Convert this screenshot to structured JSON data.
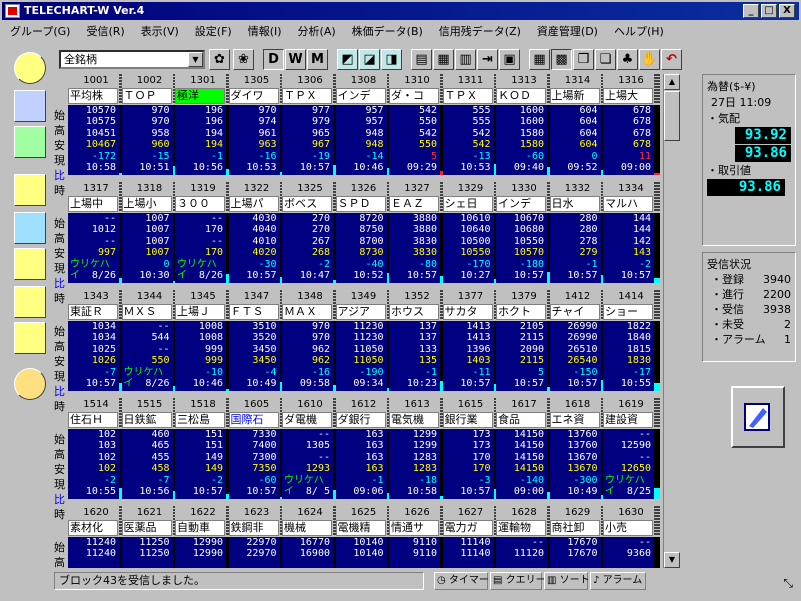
{
  "window": {
    "title": "TELECHART-W Ver.4",
    "min": "_",
    "max": "□",
    "close": "X"
  },
  "menu": [
    "グループ(G)",
    "受信(R)",
    "表示(V)",
    "設定(F)",
    "情報(I)",
    "分析(A)",
    "株価データ(B)",
    "信用残データ(Z)",
    "資産管理(D)",
    "ヘルプ(H)"
  ],
  "toolbar": {
    "combo_value": "全銘柄",
    "btn_d": "D",
    "btn_w": "W",
    "btn_m": "M"
  },
  "row_labels": [
    "始",
    "高",
    "安",
    "現",
    "比",
    "時"
  ],
  "colors": {
    "panel_bg": "#000080",
    "change": "#00ffff",
    "highlight": "#00ff00",
    "lcd": "#00ffff"
  },
  "rows": [
    [
      {
        "code": "1001",
        "name": "平均株",
        "vals": [
          "10570",
          "10575",
          "10451",
          "10467",
          "-172",
          "10:58"
        ]
      },
      {
        "code": "1002",
        "name": "ＴＯＰ",
        "vals": [
          "970",
          "970",
          "958",
          "960",
          "-15",
          "10:51"
        ]
      },
      {
        "code": "1301",
        "name": "極洋",
        "hl": true,
        "vals": [
          "196",
          "196",
          "194",
          "194",
          "-1",
          "10:56"
        ]
      },
      {
        "code": "1305",
        "name": "ダイワ",
        "vals": [
          "970",
          "974",
          "961",
          "963",
          "-16",
          "10:53"
        ]
      },
      {
        "code": "1306",
        "name": "ＴＰＸ",
        "vals": [
          "977",
          "979",
          "965",
          "967",
          "-19",
          "10:57"
        ]
      },
      {
        "code": "1308",
        "name": "インデ",
        "vals": [
          "957",
          "957",
          "948",
          "948",
          "-14",
          "10:46"
        ]
      },
      {
        "code": "1310",
        "name": "ダ・コ",
        "vals": [
          "542",
          "550",
          "542",
          "550",
          "5",
          "09:29"
        ],
        "red": true
      },
      {
        "code": "1311",
        "name": "ＴＰＸ",
        "vals": [
          "555",
          "555",
          "542",
          "542",
          "-13",
          "10:53"
        ]
      },
      {
        "code": "1313",
        "name": "ＫＯＤ",
        "vals": [
          "1600",
          "1600",
          "1580",
          "1580",
          "-60",
          "09:40"
        ]
      },
      {
        "code": "1314",
        "name": "上場新",
        "vals": [
          "604",
          "604",
          "604",
          "604",
          "0",
          "09:52"
        ]
      },
      {
        "code": "1316",
        "name": "上場大",
        "vals": [
          "678",
          "678",
          "678",
          "678",
          "11",
          "09:00"
        ],
        "red": true
      }
    ],
    [
      {
        "code": "1317",
        "name": "上場中",
        "vals": [
          "--",
          "1012",
          "--",
          "997",
          "ウリケハイ",
          "8/26"
        ]
      },
      {
        "code": "1318",
        "name": "上場小",
        "vals": [
          "1007",
          "1007",
          "1007",
          "1007",
          "0",
          "10:30"
        ]
      },
      {
        "code": "1319",
        "name": "３００",
        "vals": [
          "--",
          "170",
          "--",
          "170",
          "ウリケハイ",
          "8/26"
        ]
      },
      {
        "code": "1322",
        "name": "上場パ",
        "vals": [
          "4030",
          "4040",
          "4010",
          "4020",
          "-30",
          "10:57"
        ]
      },
      {
        "code": "1325",
        "name": "ボベス",
        "vals": [
          "270",
          "270",
          "267",
          "268",
          "-2",
          "10:47"
        ]
      },
      {
        "code": "1326",
        "name": "ＳＰＤ",
        "vals": [
          "8720",
          "8750",
          "8700",
          "8730",
          "-40",
          "10:52"
        ]
      },
      {
        "code": "1327",
        "name": "ＥＡＺ",
        "vals": [
          "3880",
          "3880",
          "3830",
          "3830",
          "-80",
          "10:57"
        ]
      },
      {
        "code": "1329",
        "name": "シェ日",
        "vals": [
          "10610",
          "10640",
          "10500",
          "10550",
          "-170",
          "10:27"
        ]
      },
      {
        "code": "1330",
        "name": "インデ",
        "vals": [
          "10670",
          "10680",
          "10550",
          "10570",
          "-180",
          "10:57"
        ]
      },
      {
        "code": "1332",
        "name": "日水",
        "vals": [
          "280",
          "280",
          "278",
          "279",
          "-1",
          "10:57"
        ]
      },
      {
        "code": "1334",
        "name": "マルハ",
        "vals": [
          "144",
          "144",
          "142",
          "143",
          "-2",
          "10:57"
        ]
      }
    ],
    [
      {
        "code": "1343",
        "name": "東証Ｒ",
        "vals": [
          "1034",
          "1034",
          "1025",
          "1026",
          "-7",
          "10:57"
        ]
      },
      {
        "code": "1344",
        "name": "ＭＸＳ",
        "vals": [
          "--",
          "544",
          "--",
          "550",
          "ウリケハイ",
          "8/26"
        ]
      },
      {
        "code": "1345",
        "name": "上場Ｊ",
        "vals": [
          "1008",
          "1008",
          "999",
          "999",
          "-10",
          "10:46"
        ]
      },
      {
        "code": "1347",
        "name": "ＦＴＳ",
        "vals": [
          "3510",
          "3520",
          "3450",
          "3450",
          "-4",
          "10:49"
        ]
      },
      {
        "code": "1348",
        "name": "ＭＡＸ",
        "vals": [
          "970",
          "970",
          "962",
          "962",
          "-16",
          "09:58"
        ]
      },
      {
        "code": "1349",
        "name": "アジア",
        "vals": [
          "11230",
          "11230",
          "11050",
          "11050",
          "-190",
          "09:34"
        ]
      },
      {
        "code": "1352",
        "name": "ホウス",
        "vals": [
          "137",
          "137",
          "133",
          "135",
          "-1",
          "10:23"
        ]
      },
      {
        "code": "1377",
        "name": "サカタ",
        "vals": [
          "1413",
          "1413",
          "1396",
          "1403",
          "-11",
          "10:57"
        ]
      },
      {
        "code": "1379",
        "name": "ホクト",
        "vals": [
          "2105",
          "2115",
          "2090",
          "2115",
          "5",
          "10:57"
        ]
      },
      {
        "code": "1412",
        "name": "チャイ",
        "vals": [
          "26990",
          "26990",
          "26510",
          "26540",
          "-150",
          "10:57"
        ]
      },
      {
        "code": "1414",
        "name": "ショー",
        "vals": [
          "1822",
          "1840",
          "1815",
          "1830",
          "-17",
          "10:55"
        ]
      }
    ],
    [
      {
        "code": "1514",
        "name": "住石Ｈ",
        "vals": [
          "102",
          "103",
          "102",
          "102",
          "-2",
          "10:55"
        ]
      },
      {
        "code": "1515",
        "name": "日鉄鉱",
        "vals": [
          "460",
          "465",
          "455",
          "458",
          "-7",
          "10:56"
        ]
      },
      {
        "code": "1518",
        "name": "三松島",
        "vals": [
          "151",
          "151",
          "149",
          "149",
          "-2",
          "10:57"
        ]
      },
      {
        "code": "1605",
        "name": "国際石",
        "blue": true,
        "vals": [
          "7330",
          "7400",
          "7300",
          "7350",
          "-60",
          "10:57"
        ]
      },
      {
        "code": "1610",
        "name": "ダ電機",
        "vals": [
          "--",
          "1305",
          "--",
          "1293",
          "ウリケハイ",
          "8/ 5"
        ]
      },
      {
        "code": "1612",
        "name": "ダ銀行",
        "vals": [
          "163",
          "163",
          "163",
          "163",
          "-1",
          "09:06"
        ]
      },
      {
        "code": "1613",
        "name": "電気機",
        "vals": [
          "1299",
          "1299",
          "1283",
          "1283",
          "-18",
          "10:58"
        ]
      },
      {
        "code": "1615",
        "name": "銀行業",
        "vals": [
          "173",
          "173",
          "170",
          "170",
          "-3",
          "10:57"
        ]
      },
      {
        "code": "1617",
        "name": "食品",
        "vals": [
          "14150",
          "14150",
          "14150",
          "14150",
          "-140",
          "09:00"
        ]
      },
      {
        "code": "1618",
        "name": "エネ資",
        "vals": [
          "13760",
          "13760",
          "13670",
          "13670",
          "-300",
          "10:49"
        ]
      },
      {
        "code": "1619",
        "name": "建設資",
        "vals": [
          "--",
          "12590",
          "--",
          "12650",
          "ウリケハイ",
          "8/25"
        ]
      }
    ],
    [
      {
        "code": "1620",
        "name": "素材化",
        "vals": [
          "11240",
          "11240"
        ]
      },
      {
        "code": "1621",
        "name": "医薬品",
        "vals": [
          "11250",
          "11250"
        ]
      },
      {
        "code": "1622",
        "name": "自動車",
        "vals": [
          "12990",
          "12990"
        ]
      },
      {
        "code": "1623",
        "name": "鉄鋼非",
        "vals": [
          "22970",
          "22970"
        ]
      },
      {
        "code": "1624",
        "name": "機械",
        "vals": [
          "16770",
          "16900"
        ]
      },
      {
        "code": "1625",
        "name": "電機精",
        "vals": [
          "10140",
          "10140"
        ]
      },
      {
        "code": "1626",
        "name": "情通サ",
        "vals": [
          "9110",
          "9110"
        ]
      },
      {
        "code": "1627",
        "name": "電力ガ",
        "vals": [
          "11140",
          "11140"
        ]
      },
      {
        "code": "1628",
        "name": "運輸物",
        "vals": [
          "--",
          "11120"
        ]
      },
      {
        "code": "1629",
        "name": "商社卸",
        "vals": [
          "17670",
          "17670"
        ]
      },
      {
        "code": "1630",
        "name": "小売",
        "vals": [
          "--",
          "9360"
        ]
      }
    ]
  ],
  "rpanel": {
    "fx_label": "為替($-¥)",
    "time": "27日 11:09",
    "kehai": "・気配",
    "bid": "93.92",
    "ask": "93.86",
    "torihiki": "・取引値",
    "trade": "93.86"
  },
  "recv": {
    "title": "受信状況",
    "items": [
      [
        "・登録",
        "3940"
      ],
      [
        "・進行",
        "2200"
      ],
      [
        "・受信",
        "3938"
      ],
      [
        "・未受",
        "2"
      ],
      [
        "・アラーム",
        "1"
      ]
    ]
  },
  "status": {
    "text": "ブロック43を受信しました。",
    "timer": "タイマー",
    "query": "クエリー",
    "sort": "ソート",
    "alarm": "アラーム"
  }
}
